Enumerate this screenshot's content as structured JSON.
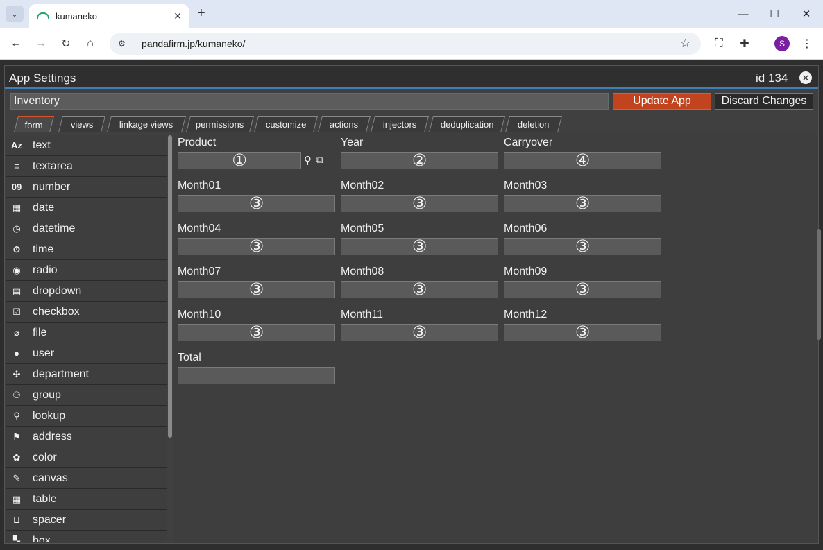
{
  "browser": {
    "tab_title": "kumaneko",
    "url": "pandafirm.jp/kumaneko/",
    "profile_initial": "S"
  },
  "panel": {
    "title": "App Settings",
    "id_label": "id 134",
    "app_name": "Inventory",
    "update_label": "Update App",
    "discard_label": "Discard Changes"
  },
  "tabs": [
    {
      "label": "form"
    },
    {
      "label": "views"
    },
    {
      "label": "linkage views"
    },
    {
      "label": "permissions"
    },
    {
      "label": "customize"
    },
    {
      "label": "actions"
    },
    {
      "label": "injectors"
    },
    {
      "label": "deduplication"
    },
    {
      "label": "deletion"
    }
  ],
  "sidebar": {
    "items": [
      {
        "label": "text",
        "icon": "Az"
      },
      {
        "label": "textarea",
        "icon": "≡"
      },
      {
        "label": "number",
        "icon": "09"
      },
      {
        "label": "date",
        "icon": "▦"
      },
      {
        "label": "datetime",
        "icon": "◷"
      },
      {
        "label": "time",
        "icon": "⏱"
      },
      {
        "label": "radio",
        "icon": "◉"
      },
      {
        "label": "dropdown",
        "icon": "▤"
      },
      {
        "label": "checkbox",
        "icon": "☑"
      },
      {
        "label": "file",
        "icon": "⌀"
      },
      {
        "label": "user",
        "icon": "●"
      },
      {
        "label": "department",
        "icon": "✣"
      },
      {
        "label": "group",
        "icon": "⚇"
      },
      {
        "label": "lookup",
        "icon": "⚲"
      },
      {
        "label": "address",
        "icon": "⚑"
      },
      {
        "label": "color",
        "icon": "✿"
      },
      {
        "label": "canvas",
        "icon": "✎"
      },
      {
        "label": "table",
        "icon": "▦"
      },
      {
        "label": "spacer",
        "icon": "⊔"
      },
      {
        "label": "box",
        "icon": "▚"
      }
    ]
  },
  "form": {
    "fields": [
      {
        "label": "Product",
        "marker": "①"
      },
      {
        "label": "Year",
        "marker": "②"
      },
      {
        "label": "Carryover",
        "marker": "④"
      },
      {
        "label": "Month01",
        "marker": "③"
      },
      {
        "label": "Month02",
        "marker": "③"
      },
      {
        "label": "Month03",
        "marker": "③"
      },
      {
        "label": "Month04",
        "marker": "③"
      },
      {
        "label": "Month05",
        "marker": "③"
      },
      {
        "label": "Month06",
        "marker": "③"
      },
      {
        "label": "Month07",
        "marker": "③"
      },
      {
        "label": "Month08",
        "marker": "③"
      },
      {
        "label": "Month09",
        "marker": "③"
      },
      {
        "label": "Month10",
        "marker": "③"
      },
      {
        "label": "Month11",
        "marker": "③"
      },
      {
        "label": "Month12",
        "marker": "③"
      },
      {
        "label": "Total",
        "marker": ""
      }
    ]
  },
  "colors": {
    "accent": "#c1441f",
    "header_underline": "#3d7fb8",
    "panel_bg": "#404040"
  }
}
